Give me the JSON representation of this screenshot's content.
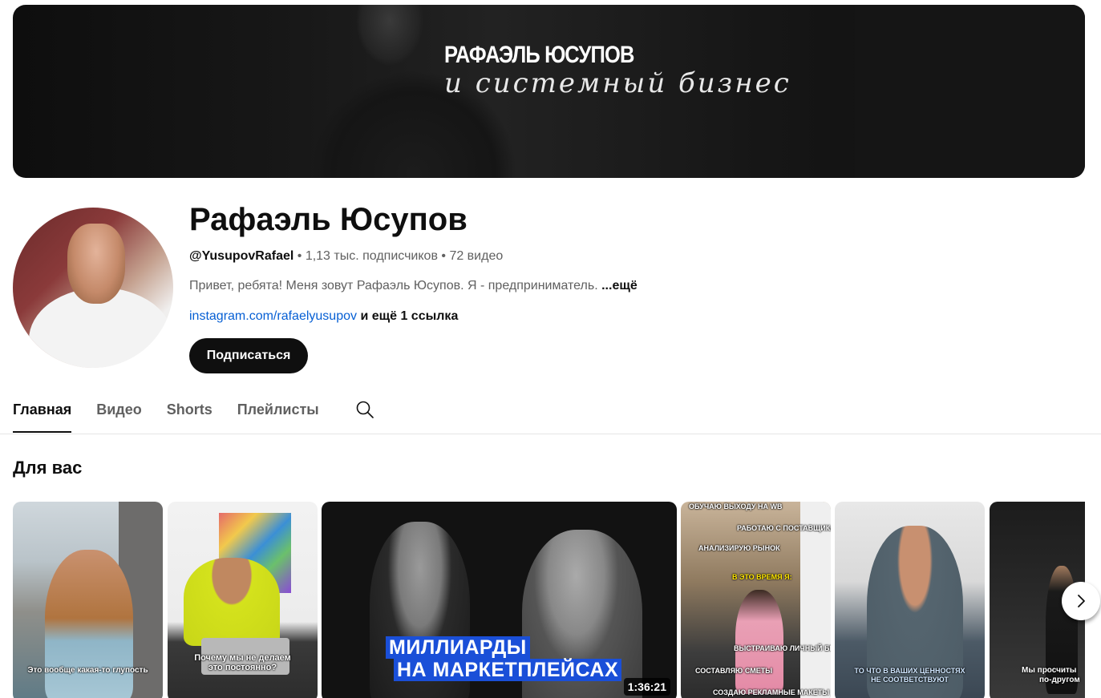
{
  "banner": {
    "title": "РАФАЭЛЬ ЮСУПОВ",
    "subtitle": "и системный бизнес"
  },
  "channel": {
    "name": "Рафаэль Юсупов",
    "handle": "@YusupovRafael",
    "subscribers": "1,13 тыс. подписчиков",
    "videos": "72 видео",
    "separator": " • ",
    "description": "Привет, ребята! Меня зовут Рафаэль Юсупов. Я - предприниматель.",
    "more_label": "...ещё",
    "link_text": "instagram.com/rafaelyusupov",
    "extra_links": "и ещё 1 ссылка",
    "subscribe_label": "Подписаться"
  },
  "tabs": [
    {
      "label": "Главная",
      "active": true
    },
    {
      "label": "Видео",
      "active": false
    },
    {
      "label": "Shorts",
      "active": false
    },
    {
      "label": "Плейлисты",
      "active": false
    }
  ],
  "section": {
    "title": "Для вас"
  },
  "cards": [
    {
      "type": "short",
      "caption": "Это вообще какая-то глупость"
    },
    {
      "type": "short",
      "caption_line1": "Почему мы не делаем",
      "caption_line2": "это постоянно?"
    },
    {
      "type": "video",
      "title_line1": "МИЛЛИАРДЫ",
      "title_line2": "НА МАРКЕТПЛЕЙСАХ",
      "duration": "1:36:21"
    },
    {
      "type": "short",
      "labels": [
        "ОБУЧАЮ ВЫХОДУ НА WB",
        "РАБОТАЮ С ПОСТАВЩИКАМИ",
        "АНАЛИЗИРУЮ РЫНОК",
        "В ЭТО ВРЕМЯ Я:",
        "ВЫСТРАИВАЮ ЛИЧНЫЙ БРЕНД",
        "СОСТАВЛЯЮ СМЕТЫ",
        "СОЗДАЮ РЕКЛАМНЫЕ МАКЕТЫ"
      ]
    },
    {
      "type": "short",
      "caption_line1": "ТО ЧТО В ВАШИХ ЦЕННОСТЯХ",
      "caption_line2": "НЕ СООТВЕТСТВУЮТ"
    },
    {
      "type": "short",
      "caption_line1": "Мы просчиты",
      "caption_line2": "по-другом"
    }
  ],
  "icons": {
    "search": "search-icon",
    "next": "chevron-right-icon"
  },
  "colors": {
    "subscribe_bg": "#0f0f0f",
    "link": "#065fd4",
    "video_title_bg": "#1a4fd8"
  }
}
